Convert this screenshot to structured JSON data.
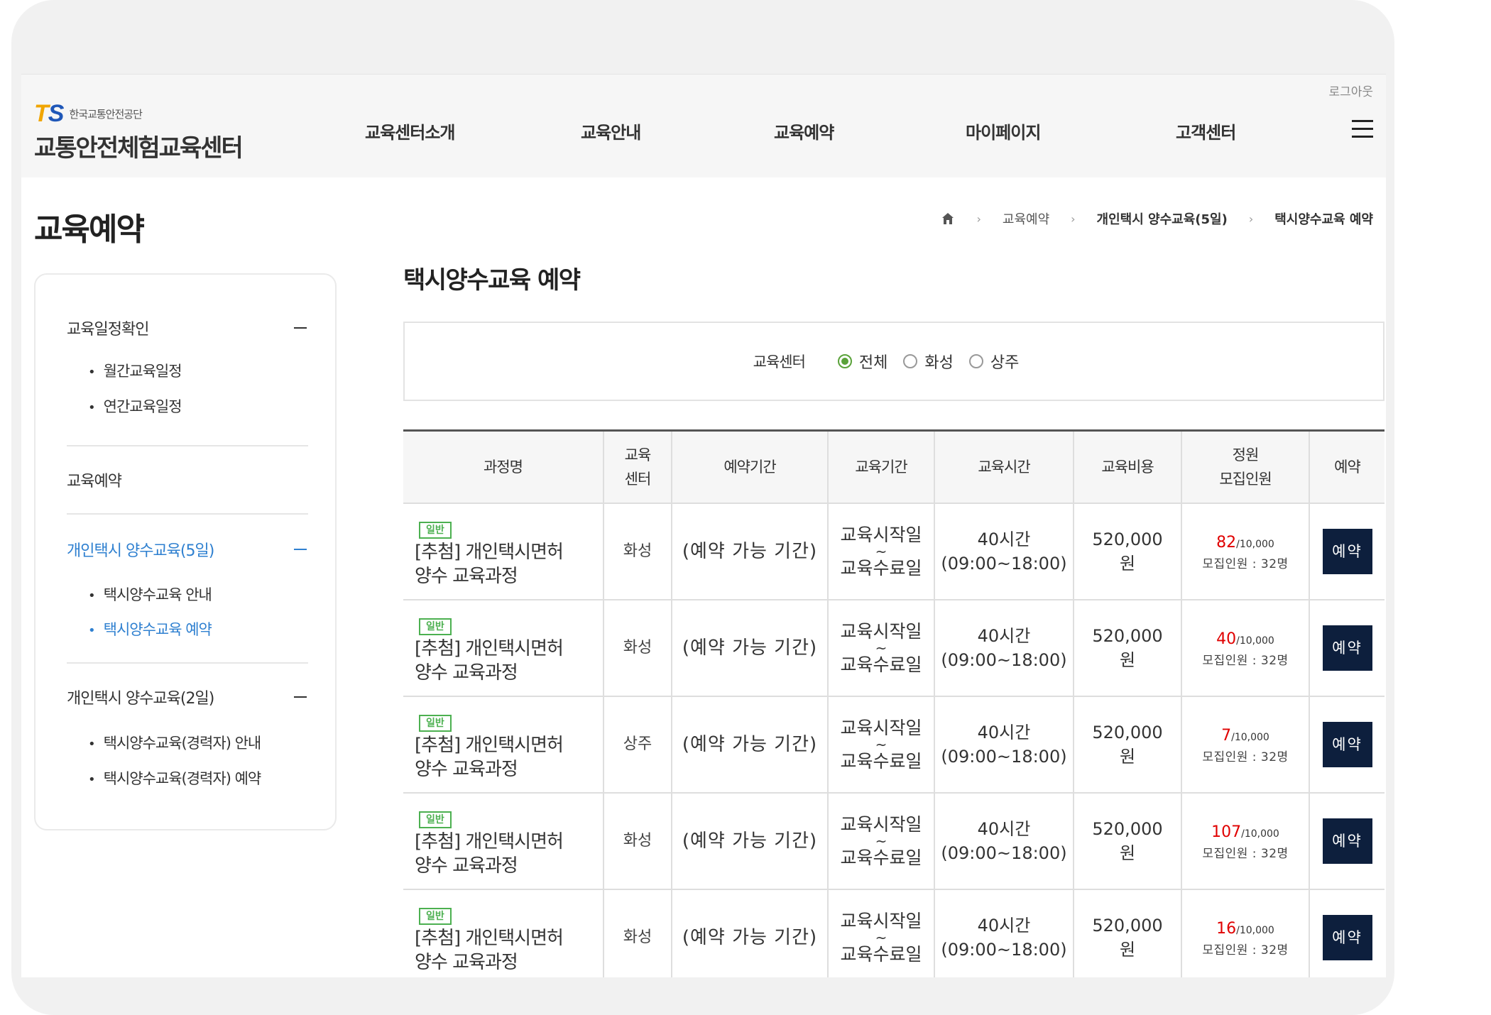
{
  "header": {
    "logo": {
      "mark_t": "T",
      "mark_s": "S",
      "org": "한국교통안전공단",
      "name": "교통안전체험교육센터"
    },
    "logout": "로그아웃",
    "nav": [
      "교육센터소개",
      "교육안내",
      "교육예약",
      "마이페이지",
      "고객센터"
    ]
  },
  "page": {
    "title": "교육예약",
    "breadcrumb": [
      "교육예약",
      "개인택시 양수교육(5일)",
      "택시양수교육 예약"
    ]
  },
  "sidebar": {
    "groups": [
      {
        "label": "교육일정확인",
        "items": [
          "월간교육일정",
          "연간교육일정"
        ]
      },
      {
        "label": "교육예약",
        "items": []
      },
      {
        "label": "개인택시 양수교육(5일)",
        "items": [
          "택시양수교육 안내",
          "택시양수교육 예약"
        ]
      },
      {
        "label": "개인택시 양수교육(2일)",
        "items": [
          "택시양수교육(경력자) 안내",
          "택시양수교육(경력자) 예약"
        ]
      }
    ]
  },
  "content": {
    "title": "택시양수교육 예약",
    "filter": {
      "label": "교육센터",
      "options": [
        "전체",
        "화성",
        "상주"
      ],
      "selected": "전체"
    },
    "table": {
      "headers": {
        "name": "과정명",
        "center_1": "교육",
        "center_2": "센터",
        "period": "예약기간",
        "edu_period": "교육기간",
        "time": "교육시간",
        "cost": "교육비용",
        "cap_1": "정원",
        "cap_2": "모집인원",
        "reserve": "예약"
      },
      "rows": [
        {
          "badge": "일반",
          "name_1": "[추첨] 개인택시면허",
          "name_2": "양수 교육과정",
          "center": "화성",
          "period": "(예약 가능 기간)",
          "edu_start": "교육시작일",
          "tilde": "~",
          "edu_end": "교육수료일",
          "hours": "40시간",
          "hours_range": "(09:00~18:00)",
          "cost": "520,000",
          "cost_unit": "원",
          "applied": "82",
          "capacity": "/10,000",
          "recruit": "모집인원 : 32명",
          "button": "예약"
        },
        {
          "badge": "일반",
          "name_1": "[추첨] 개인택시면허",
          "name_2": "양수 교육과정",
          "center": "화성",
          "period": "(예약 가능 기간)",
          "edu_start": "교육시작일",
          "tilde": "~",
          "edu_end": "교육수료일",
          "hours": "40시간",
          "hours_range": "(09:00~18:00)",
          "cost": "520,000",
          "cost_unit": "원",
          "applied": "40",
          "capacity": "/10,000",
          "recruit": "모집인원 : 32명",
          "button": "예약"
        },
        {
          "badge": "일반",
          "name_1": "[추첨] 개인택시면허",
          "name_2": "양수 교육과정",
          "center": "상주",
          "period": "(예약 가능 기간)",
          "edu_start": "교육시작일",
          "tilde": "~",
          "edu_end": "교육수료일",
          "hours": "40시간",
          "hours_range": "(09:00~18:00)",
          "cost": "520,000",
          "cost_unit": "원",
          "applied": "7",
          "capacity": "/10,000",
          "recruit": "모집인원 : 32명",
          "button": "예약"
        },
        {
          "badge": "일반",
          "name_1": "[추첨] 개인택시면허",
          "name_2": "양수 교육과정",
          "center": "화성",
          "period": "(예약 가능 기간)",
          "edu_start": "교육시작일",
          "tilde": "~",
          "edu_end": "교육수료일",
          "hours": "40시간",
          "hours_range": "(09:00~18:00)",
          "cost": "520,000",
          "cost_unit": "원",
          "applied": "107",
          "capacity": "/10,000",
          "recruit": "모집인원 : 32명",
          "button": "예약"
        },
        {
          "badge": "일반",
          "name_1": "[추첨] 개인택시면허",
          "name_2": "양수 교육과정",
          "center": "화성",
          "period": "(예약 가능 기간)",
          "edu_start": "교육시작일",
          "tilde": "~",
          "edu_end": "교육수료일",
          "hours": "40시간",
          "hours_range": "(09:00~18:00)",
          "cost": "520,000",
          "cost_unit": "원",
          "applied": "16",
          "capacity": "/10,000",
          "recruit": "모집인원 : 32명",
          "button": "예약"
        }
      ]
    }
  },
  "colors": {
    "active_blue": "#2f80d0",
    "badge_green": "#4cb050",
    "radio_green": "#5aa23a",
    "count_red": "#e00000",
    "button_navy": "#0d1f3d",
    "logo_t": "#f0a500",
    "logo_s": "#1f57b8"
  },
  "icons": {
    "home": "home-icon",
    "breadcrumb_sep": "chevron-right-icon",
    "menu": "hamburger-menu-icon",
    "collapse": "minus-icon"
  }
}
